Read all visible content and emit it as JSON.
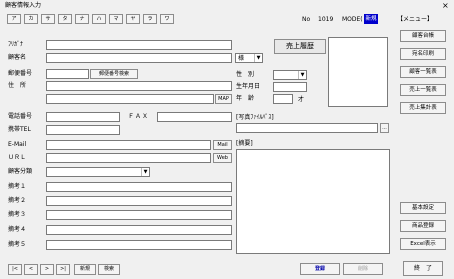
{
  "window": {
    "title": "顧客情報入力",
    "close": "×"
  },
  "kana_tabs": [
    "ア",
    "カ",
    "サ",
    "タ",
    "ナ",
    "ハ",
    "マ",
    "ヤ",
    "ラ",
    "ワ"
  ],
  "record": {
    "no_label": "No",
    "no_value": "1019",
    "mode_label": "MODE(",
    "mode_value": "新規"
  },
  "sidebar": {
    "menu_label": "【メニュー】",
    "top_buttons": [
      "顧客台帳",
      "宛名印刷",
      "顧客一覧表",
      "売上一覧表",
      "売上集計表"
    ],
    "bottom_buttons": [
      "基本設定",
      "商品登録",
      "Excel表示"
    ]
  },
  "form": {
    "furigana": "ﾌﾘｶﾞﾅ",
    "customer_name": "顧客名",
    "honorific": "様",
    "sales_history": "売上履歴",
    "postal": "郵便番号",
    "postal_search": "郵便番号検索",
    "address": "住　所",
    "map": "MAP",
    "gender": "性　別",
    "birthday": "生年月日",
    "age": "年　齢",
    "age_unit": "才",
    "phone": "電話番号",
    "fax": "ＦＡＸ",
    "mobile": "携帯TEL",
    "photo_file": "[写真ﾌｧｲﾙﾊﾟｽ]",
    "browse": "...",
    "email": "E-Mail",
    "mail_btn": "Mail",
    "url": "ＵＲＬ",
    "web_btn": "Web",
    "category": "顧客分類",
    "notes_header": "[摘要]",
    "remarks": [
      "摘考１",
      "摘考２",
      "摘考３",
      "摘考４",
      "摘考５"
    ]
  },
  "footer": {
    "nav": [
      "|<",
      "<",
      ">",
      ">|"
    ],
    "new": "新規",
    "search": "検索",
    "register": "登録",
    "delete": "削除",
    "end": "終　了"
  }
}
